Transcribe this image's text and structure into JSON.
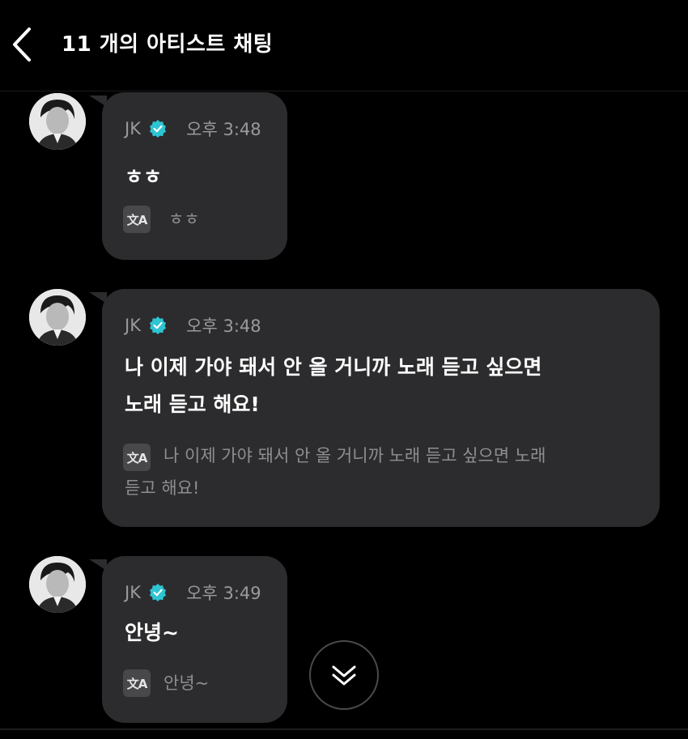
{
  "header": {
    "title": "11 개의 아티스트 채팅",
    "back_icon": "chevron-left-icon"
  },
  "messages": [
    {
      "sender": "JK",
      "verified": true,
      "time": "오후 3:48",
      "text": "ㅎㅎ",
      "translation": "ㅎㅎ"
    },
    {
      "sender": "JK",
      "verified": true,
      "time": "오후 3:48",
      "text_lines": [
        "나 이제 가야 돼서 안 올 거니까 노래 듣고 싶으면",
        "노래 듣고 해요!"
      ],
      "translation_lines": [
        "나 이제 가야 돼서 안 올 거니까 노래 듣고 싶으면 노래",
        "듣고 해요!"
      ]
    },
    {
      "sender": "JK",
      "verified": true,
      "time": "오후 3:49",
      "text": "안녕~",
      "translation": "안녕~"
    }
  ],
  "translate_icon_label": "文A",
  "scroll_button_icon": "double-chevron-down-icon",
  "colors": {
    "background": "#000000",
    "bubble": "#2c2c2e",
    "verified_badge": "#2ec5d3",
    "meta_text": "#9a9a9e",
    "translation_text": "#8e8e93"
  }
}
